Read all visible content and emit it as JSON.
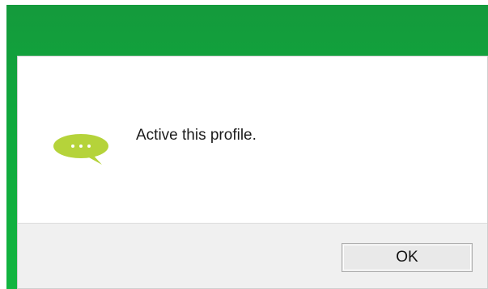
{
  "dialog": {
    "message": "Active this profile.",
    "ok_label": "OK"
  },
  "icons": {
    "message": "speech-bubble-icon"
  },
  "colors": {
    "frame_green": "#12b540",
    "bubble_green": "#b5d33a",
    "footer_gray": "#f0f0f0"
  }
}
